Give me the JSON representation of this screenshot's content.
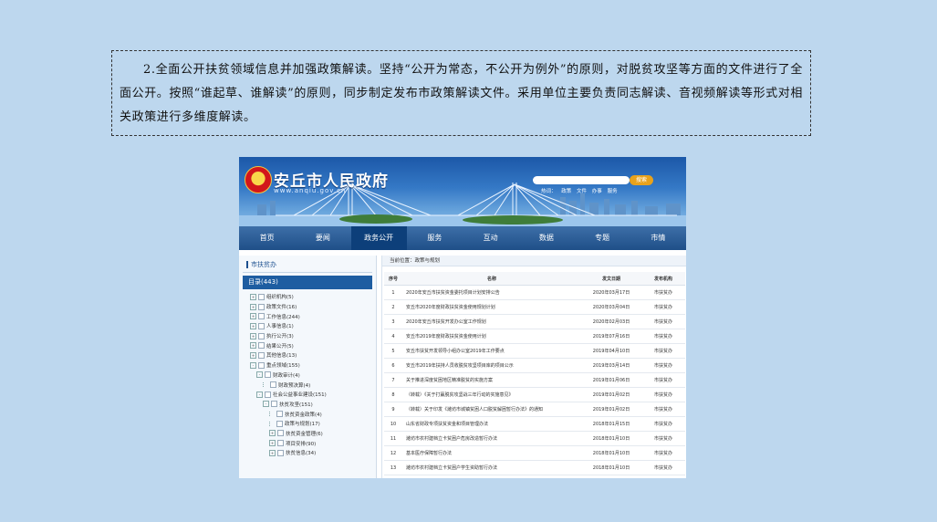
{
  "slide": {
    "text": "2.全面公开扶贫领域信息并加强政策解读。坚持“公开为常态，不公开为例外”的原则，对脱贫攻坚等方面的文件进行了全面公开。按照“谁起草、谁解读”的原则，同步制定发布市政策解读文件。采用单位主要负责同志解读、音视频解读等形式对相关政策进行多维度解读。"
  },
  "website": {
    "site_name": "安丘市人民政府",
    "site_url": "www.anqiu.gov.cn",
    "search_button": "搜索",
    "hot_label": "热词：",
    "hot_words": [
      "政策",
      "文件",
      "办事",
      "服务"
    ],
    "nav": [
      "首页",
      "要闻",
      "政务公开",
      "服务",
      "互动",
      "数据",
      "专题",
      "市情"
    ],
    "nav_active_index": 2,
    "sidebar": {
      "title": "市扶贫办",
      "catalog": "目录(443)",
      "tree": [
        {
          "label": "组织机构(5)",
          "level": 1,
          "toggle": "+"
        },
        {
          "label": "政策文件(16)",
          "level": 1,
          "toggle": "+"
        },
        {
          "label": "工作信息(244)",
          "level": 1,
          "toggle": "+"
        },
        {
          "label": "人事信息(1)",
          "level": 1,
          "toggle": "+"
        },
        {
          "label": "执行公开(3)",
          "level": 1,
          "toggle": "+"
        },
        {
          "label": "结果公开(5)",
          "level": 1,
          "toggle": "+"
        },
        {
          "label": "其他信息(13)",
          "level": 1,
          "toggle": "+"
        },
        {
          "label": "重点领域(155)",
          "level": 1,
          "toggle": "-"
        },
        {
          "label": "财政审计(4)",
          "level": 2,
          "toggle": "-"
        },
        {
          "label": "财政预决算(4)",
          "level": 3,
          "toggle": ""
        },
        {
          "label": "社会公益事业建设(151)",
          "level": 2,
          "toggle": "-"
        },
        {
          "label": "扶贫攻坚(151)",
          "level": 3,
          "toggle": "-"
        },
        {
          "label": "扶贫资金政策(4)",
          "level": 4,
          "toggle": ""
        },
        {
          "label": "政策与规划(17)",
          "level": 4,
          "toggle": ""
        },
        {
          "label": "扶贫资金管理(6)",
          "level": 4,
          "toggle": "+"
        },
        {
          "label": "项目安排(90)",
          "level": 4,
          "toggle": "+"
        },
        {
          "label": "扶贫信息(34)",
          "level": 4,
          "toggle": "+"
        }
      ]
    },
    "breadcrumb": "当前位置：政策与规划",
    "table": {
      "headers": [
        "序号",
        "名称",
        "发文日期",
        "发布机构"
      ],
      "rows": [
        [
          "1",
          "2020年安丘市扶贫资金委托项目计划安排公告",
          "2020年03月17日",
          "市扶贫办"
        ],
        [
          "2",
          "安丘市2020年度财政扶贫资金使用规划计划",
          "2020年03月04日",
          "市扶贫办"
        ],
        [
          "3",
          "2020年安丘市扶贫开发办公室工作规划",
          "2020年02月03日",
          "市扶贫办"
        ],
        [
          "4",
          "安丘市2019年度财政扶贫资金使用计划",
          "2019年07月16日",
          "市扶贫办"
        ],
        [
          "5",
          "安丘市扶贫开发领导小组办公室2019年工作要点",
          "2019年04月10日",
          "市扶贫办"
        ],
        [
          "6",
          "安丘市2019年扶持人员收脱贫攻坚项目库的项目公示",
          "2019年03月14日",
          "市扶贫办"
        ],
        [
          "7",
          "关于推进深度贫困地区精准脱贫的实施方案",
          "2019年01月06日",
          "市扶贫办"
        ],
        [
          "8",
          "（转载）《关于打赢脱贫攻坚战三年行动的实施意见》",
          "2019年01月02日",
          "市扶贫办"
        ],
        [
          "9",
          "（转载）关于印发《潍坊市城镇贫困人口脱贫解困暂行办法》的通知",
          "2019年01月02日",
          "市扶贫办"
        ],
        [
          "10",
          "山东省财政专项扶贫资金和项目管理办法",
          "2018年01月15日",
          "市扶贫办"
        ],
        [
          "11",
          "潍坊市农村建档立卡贫困户危房改造暂行办法",
          "2018年01月10日",
          "市扶贫办"
        ],
        [
          "12",
          "基本医疗保障暂行办法",
          "2018年01月10日",
          "市扶贫办"
        ],
        [
          "13",
          "潍坊市农村建档立卡贫困户学生资助暂行办法",
          "2018年01月10日",
          "市扶贫办"
        ],
        [
          "14",
          "安丘市2017年减贫计划",
          "2017年06月12日",
          "市扶贫办"
        ],
        [
          "15",
          "扶贫资源行政分配公开实施方案",
          "2017年05月06日",
          "市扶贫办"
        ]
      ]
    },
    "colors": {
      "banner": "#3579c6",
      "nav": "#1f4f88",
      "nav_active": "#0d3f7a",
      "sidebar_header": "#1e5da1",
      "search_button": "#e8a21c",
      "slide_bg": "#bdd7ee"
    }
  }
}
